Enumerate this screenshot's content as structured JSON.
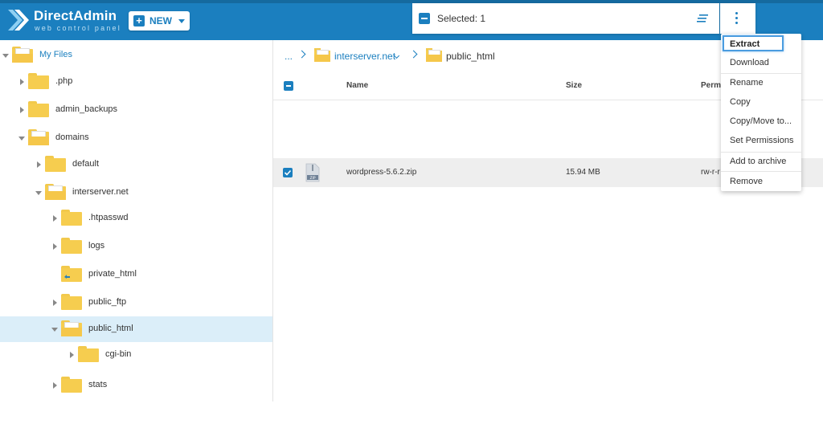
{
  "app": {
    "logo_title": "DirectAdmin",
    "logo_subtitle": "web control panel",
    "new_button": "NEW",
    "accent": "#1b7fbf"
  },
  "selection": {
    "text": "Selected: 1"
  },
  "tree": {
    "root": "My Files",
    "items": [
      {
        "label": ".php"
      },
      {
        "label": "admin_backups"
      },
      {
        "label": "domains"
      },
      {
        "label": "default"
      },
      {
        "label": "interserver.net"
      },
      {
        "label": ".htpasswd"
      },
      {
        "label": "logs"
      },
      {
        "label": "private_html"
      },
      {
        "label": "public_ftp"
      },
      {
        "label": "public_html"
      },
      {
        "label": "cgi-bin"
      },
      {
        "label": "stats"
      }
    ]
  },
  "breadcrumb": {
    "dots": "...",
    "items": [
      "interserver.net",
      "public_html"
    ]
  },
  "table": {
    "columns": {
      "name": "Name",
      "size": "Size",
      "perm": "Permi"
    },
    "rows": [
      {
        "name": "wordpress-5.6.2.zip",
        "size": "15.94 MB",
        "perm": "rw-r-r",
        "icon_text": "ZIP"
      }
    ]
  },
  "context_menu": {
    "items": [
      "Extract",
      "Download",
      "Rename",
      "Copy",
      "Copy/Move to...",
      "Set Permissions",
      "Add to archive",
      "Remove"
    ]
  }
}
